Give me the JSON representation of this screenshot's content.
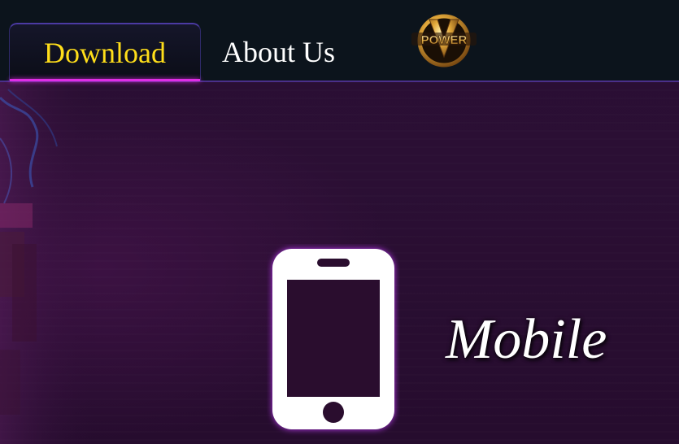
{
  "nav": {
    "tabs": [
      {
        "label": "Download",
        "active": true
      },
      {
        "label": "About Us",
        "active": false
      }
    ],
    "logo": {
      "icon": "vpower-logo-icon",
      "text": "POWER",
      "letter": "V"
    }
  },
  "main": {
    "platform_icon": "mobile-phone-icon",
    "platform_label": "Mobile"
  },
  "colors": {
    "active_tab_text": "#ffde1a",
    "active_tab_underline": "#e02ee6",
    "nav_background": "#0c141c",
    "page_background": "#260d2e"
  }
}
